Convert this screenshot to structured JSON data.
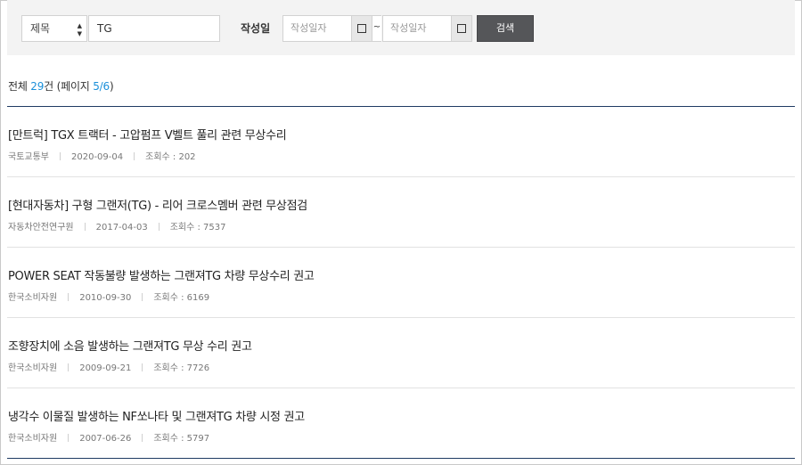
{
  "search": {
    "field_select": "제목",
    "keyword_value": "TG",
    "date_label": "작성일",
    "date_from_placeholder": "작성일자",
    "date_to_placeholder": "작성일자",
    "tilde": "~",
    "button_label": "검색"
  },
  "summary": {
    "prefix": "전체 ",
    "count": "29",
    "middle": "건 (페이지 ",
    "page": "5/6",
    "suffix": ")"
  },
  "items": [
    {
      "title": "[만트럭] TGX 트랙터 - 고압펌프 V벨트 풀리 관련 무상수리",
      "source": "국토교통부",
      "date": "2020-09-04",
      "views": "조회수 : 202"
    },
    {
      "title": "[현대자동차] 구형 그랜저(TG) - 리어 크로스멤버 관련 무상점검",
      "source": "자동차안전연구원",
      "date": "2017-04-03",
      "views": "조회수 : 7537"
    },
    {
      "title": "POWER SEAT 작동불량 발생하는 그랜져TG 차량 무상수리 권고",
      "source": "한국소비자원",
      "date": "2010-09-30",
      "views": "조회수 : 6169"
    },
    {
      "title": "조향장치에 소음 발생하는 그랜져TG 무상 수리 권고",
      "source": "한국소비자원",
      "date": "2009-09-21",
      "views": "조회수 : 7726"
    },
    {
      "title": "냉각수 이물질 발생하는 NF쏘나타 및 그랜져TG 차량 시정 권고",
      "source": "한국소비자원",
      "date": "2007-06-26",
      "views": "조회수 : 5797"
    }
  ]
}
